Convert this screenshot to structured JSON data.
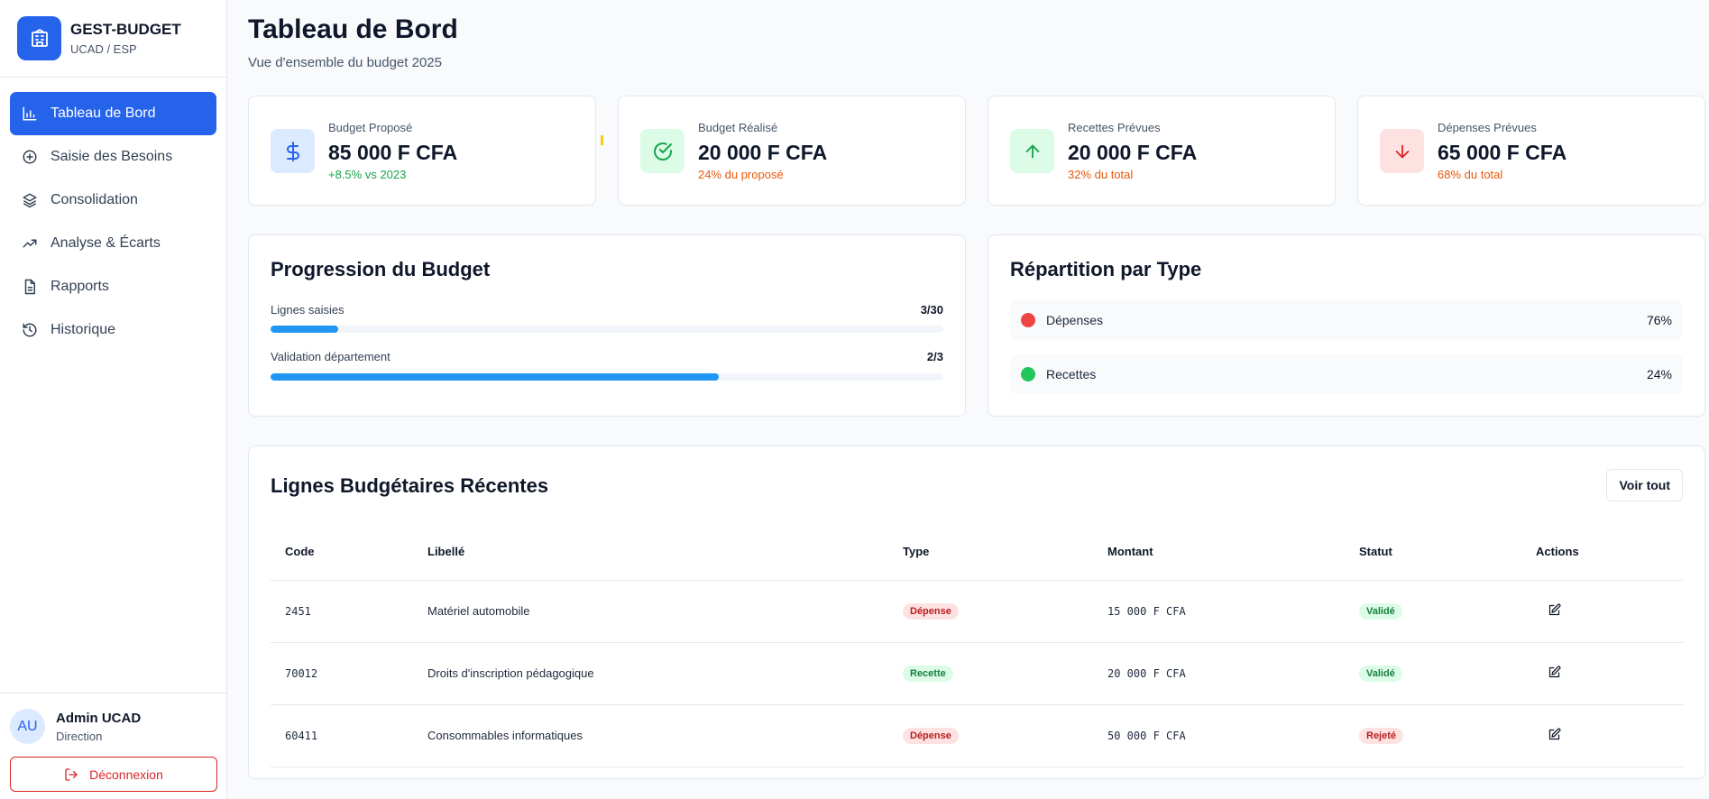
{
  "brand": {
    "title": "GEST-BUDGET",
    "subtitle": "UCAD / ESP",
    "logo_icon": "building-icon"
  },
  "nav": {
    "items": [
      {
        "label": "Tableau de Bord",
        "icon": "bar-chart-icon",
        "active": true
      },
      {
        "label": "Saisie des Besoins",
        "icon": "plus-circle-icon"
      },
      {
        "label": "Consolidation",
        "icon": "layers-icon"
      },
      {
        "label": "Analyse & Écarts",
        "icon": "trending-up-icon"
      },
      {
        "label": "Rapports",
        "icon": "file-text-icon"
      },
      {
        "label": "Historique",
        "icon": "history-icon"
      }
    ]
  },
  "user": {
    "initials": "AU",
    "name": "Admin UCAD",
    "role": "Direction",
    "logout_label": "Déconnexion"
  },
  "page": {
    "title": "Tableau de Bord",
    "subtitle": "Vue d'ensemble du budget 2025"
  },
  "stats": [
    {
      "label": "Budget Proposé",
      "value": "85 000 F CFA",
      "note": "+8.5% vs 2023",
      "note_color": "#16a34a",
      "icon": "dollar-icon",
      "icon_bg": "#dbeafe",
      "icon_color": "#2563eb"
    },
    {
      "label": "Budget Réalisé",
      "value": "20 000 F CFA",
      "note": "24% du proposé",
      "note_color": "#ea580c",
      "icon": "check-circle-icon",
      "icon_bg": "#dcfce7",
      "icon_color": "#16a34a"
    },
    {
      "label": "Recettes Prévues",
      "value": "20 000 F CFA",
      "note": "32% du total",
      "note_color": "#ea580c",
      "icon": "arrow-up-icon",
      "icon_bg": "#dcfce7",
      "icon_color": "#16a34a"
    },
    {
      "label": "Dépenses Prévues",
      "value": "65 000 F CFA",
      "note": "68% du total",
      "note_color": "#ea580c",
      "icon": "arrow-down-icon",
      "icon_bg": "#fee2e2",
      "icon_color": "#dc2626"
    }
  ],
  "progress": {
    "title": "Progression du Budget",
    "rows": [
      {
        "label": "Lignes saisies",
        "count": "3/30",
        "fraction": 0.1
      },
      {
        "label": "Validation département",
        "count": "2/3",
        "fraction": 0.6667
      }
    ]
  },
  "repartition": {
    "title": "Répartition par Type",
    "rows": [
      {
        "label": "Dépenses",
        "pct": "76%",
        "color": "#ef4444"
      },
      {
        "label": "Recettes",
        "pct": "24%",
        "color": "#22c55e"
      }
    ]
  },
  "recent": {
    "title": "Lignes Budgétaires Récentes",
    "view_all_label": "Voir tout",
    "columns": [
      "Code",
      "Libellé",
      "Type",
      "Montant",
      "Statut",
      "Actions"
    ],
    "rows": [
      {
        "code": "2451",
        "libelle": "Matériel automobile",
        "type": "Dépense",
        "montant": "15 000 F CFA",
        "statut": "Validé"
      },
      {
        "code": "70012",
        "libelle": "Droits d'inscription pédagogique",
        "type": "Recette",
        "montant": "20 000 F CFA",
        "statut": "Validé"
      },
      {
        "code": "60411",
        "libelle": "Consommables informatiques",
        "type": "Dépense",
        "montant": "50 000 F CFA",
        "statut": "Rejeté"
      }
    ]
  },
  "colors": {
    "accent": "#2563eb",
    "danger": "#dc2626",
    "success": "#16a34a",
    "progress": "#2196f3"
  }
}
